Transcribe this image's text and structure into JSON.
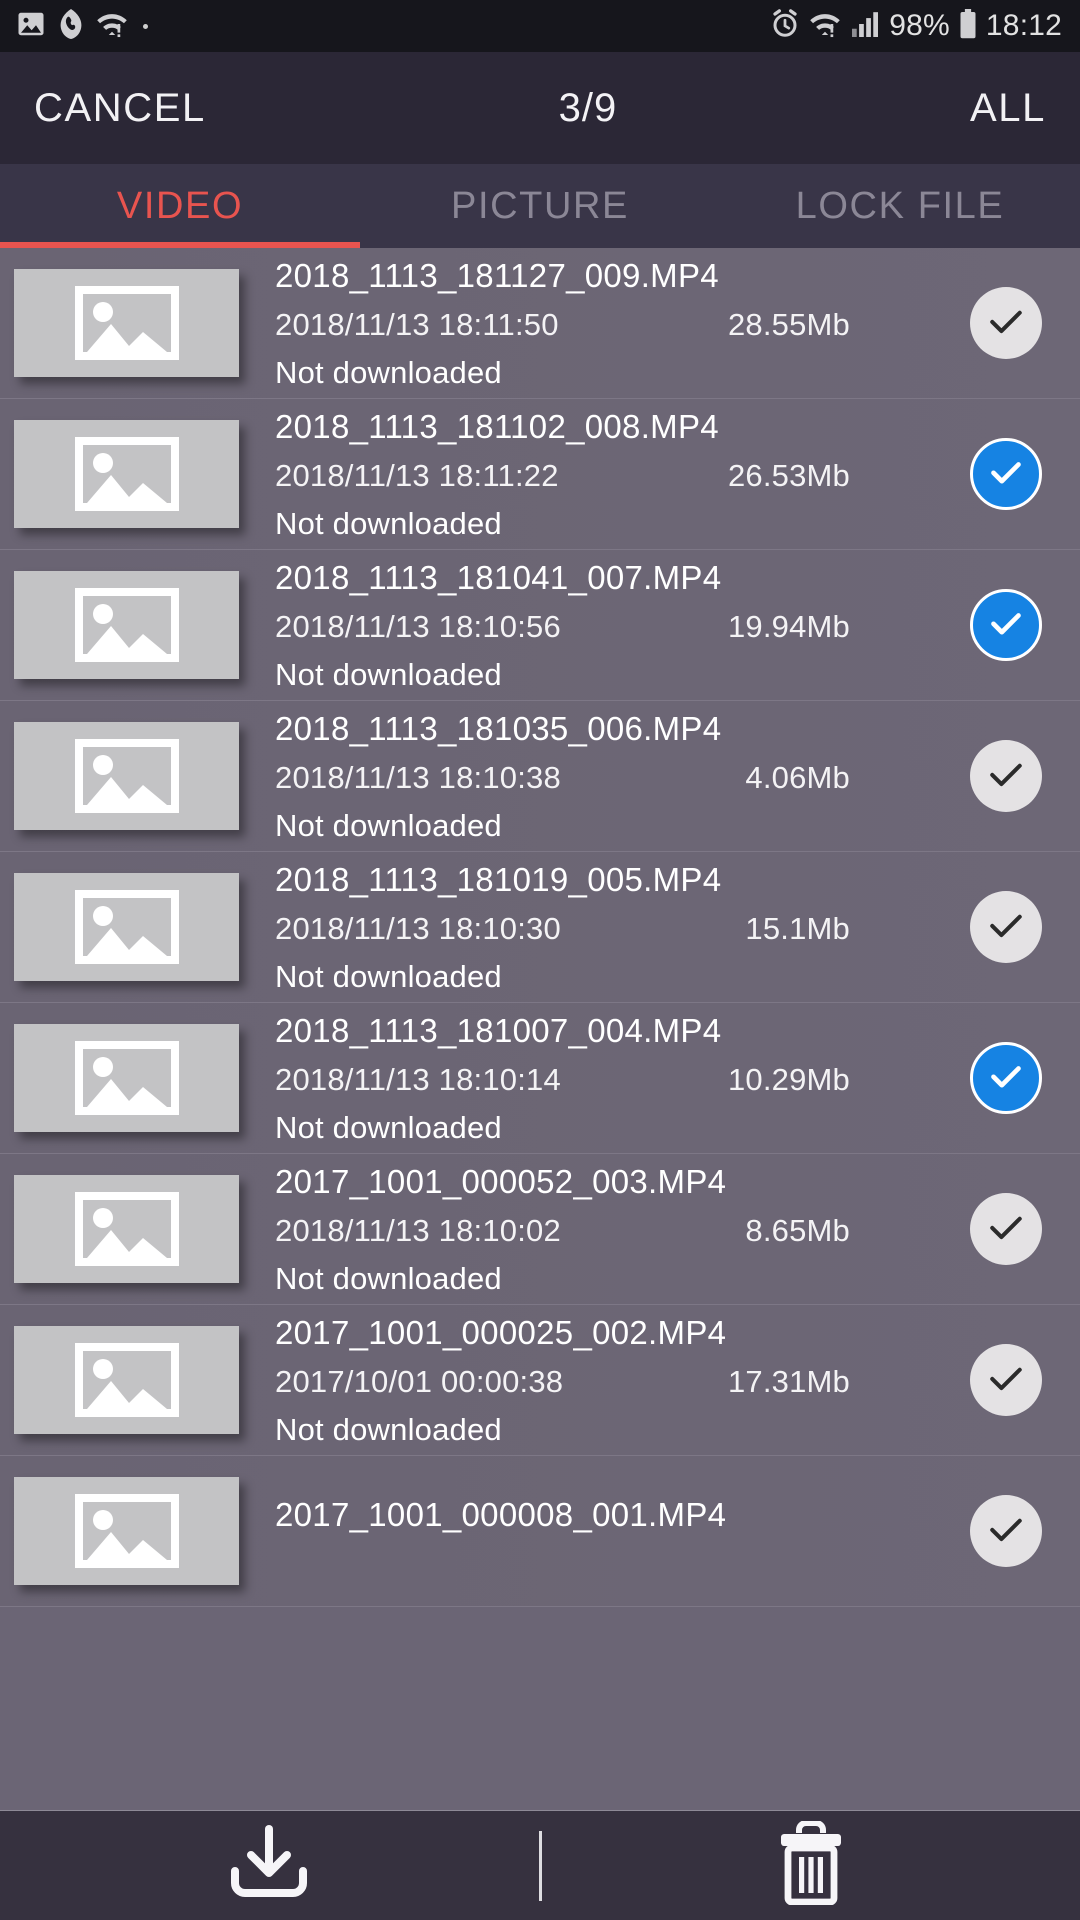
{
  "statusbar": {
    "left_icons": [
      "image-icon",
      "phone-icon",
      "wifi-alert-icon"
    ],
    "right_icons": [
      "alarm-icon",
      "wifi-alert-icon",
      "signal-icon",
      "battery-icon"
    ],
    "battery": "98%",
    "time": "18:12"
  },
  "titlebar": {
    "cancel_label": "CANCEL",
    "count_label": "3/9",
    "all_label": "ALL"
  },
  "tabs": [
    {
      "label": "VIDEO",
      "active": true
    },
    {
      "label": "PICTURE",
      "active": false
    },
    {
      "label": "LOCK FILE",
      "active": false
    }
  ],
  "colors": {
    "accent": "#e8544f",
    "checked": "#1683e3",
    "unchecked": "#e4e2e4",
    "titlebar_bg": "#2b2736",
    "tabbar_bg": "#393548",
    "list_bg": "#6b6575",
    "bottombar_bg": "#36313f",
    "statusbar_bg": "#16161c"
  },
  "files": [
    {
      "name": "2018_1113_181127_009.MP4",
      "date": "2018/11/13 18:11:50",
      "size": "28.55Mb",
      "status": "Not downloaded",
      "selected": false
    },
    {
      "name": "2018_1113_181102_008.MP4",
      "date": "2018/11/13 18:11:22",
      "size": "26.53Mb",
      "status": "Not downloaded",
      "selected": true
    },
    {
      "name": "2018_1113_181041_007.MP4",
      "date": "2018/11/13 18:10:56",
      "size": "19.94Mb",
      "status": "Not downloaded",
      "selected": true
    },
    {
      "name": "2018_1113_181035_006.MP4",
      "date": "2018/11/13 18:10:38",
      "size": "4.06Mb",
      "status": "Not downloaded",
      "selected": false
    },
    {
      "name": "2018_1113_181019_005.MP4",
      "date": "2018/11/13 18:10:30",
      "size": "15.1Mb",
      "status": "Not downloaded",
      "selected": false
    },
    {
      "name": "2018_1113_181007_004.MP4",
      "date": "2018/11/13 18:10:14",
      "size": "10.29Mb",
      "status": "Not downloaded",
      "selected": true
    },
    {
      "name": "2017_1001_000052_003.MP4",
      "date": "2018/11/13 18:10:02",
      "size": "8.65Mb",
      "status": "Not downloaded",
      "selected": false
    },
    {
      "name": "2017_1001_000025_002.MP4",
      "date": "2017/10/01 00:00:38",
      "size": "17.31Mb",
      "status": "Not downloaded",
      "selected": false
    },
    {
      "name": "2017_1001_000008_001.MP4",
      "date": "",
      "size": "",
      "status": "",
      "selected": false
    }
  ],
  "bottombar": {
    "download_icon": "download-icon",
    "delete_icon": "trash-icon"
  }
}
